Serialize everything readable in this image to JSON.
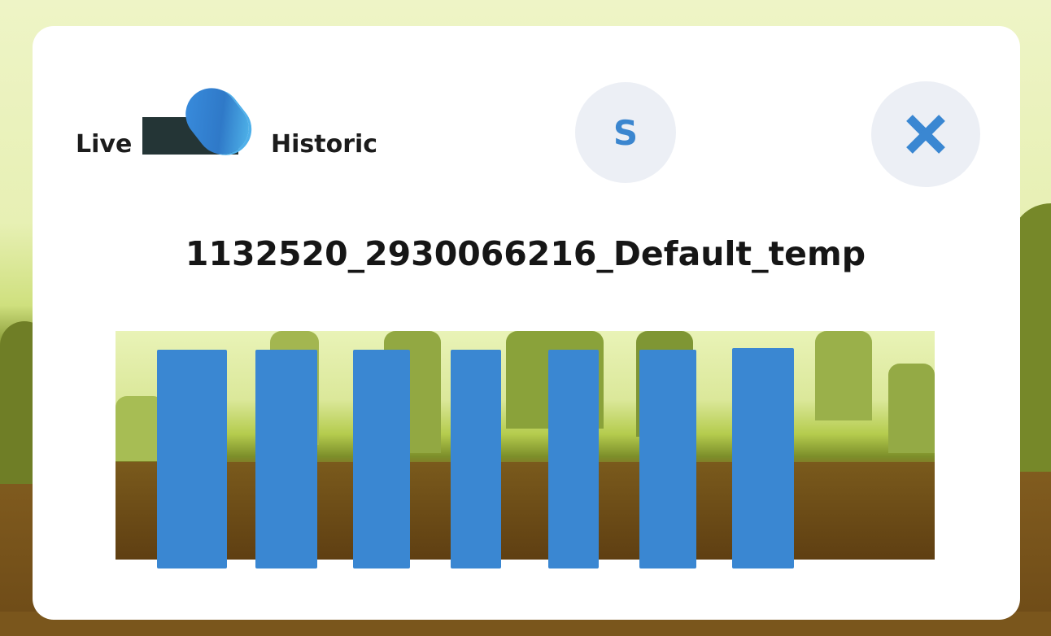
{
  "toggle": {
    "left_label": "Live",
    "right_label": "Historic"
  },
  "buttons": {
    "s_label": "S",
    "close_icon": "close-icon"
  },
  "title": "1132520_2930066216_Default_temp",
  "colors": {
    "accent": "#3a87d2",
    "toggle_track": "#243536",
    "button_bg": "#eceff5",
    "panel_bg": "#ffffff"
  },
  "bars": {
    "count": 7
  }
}
